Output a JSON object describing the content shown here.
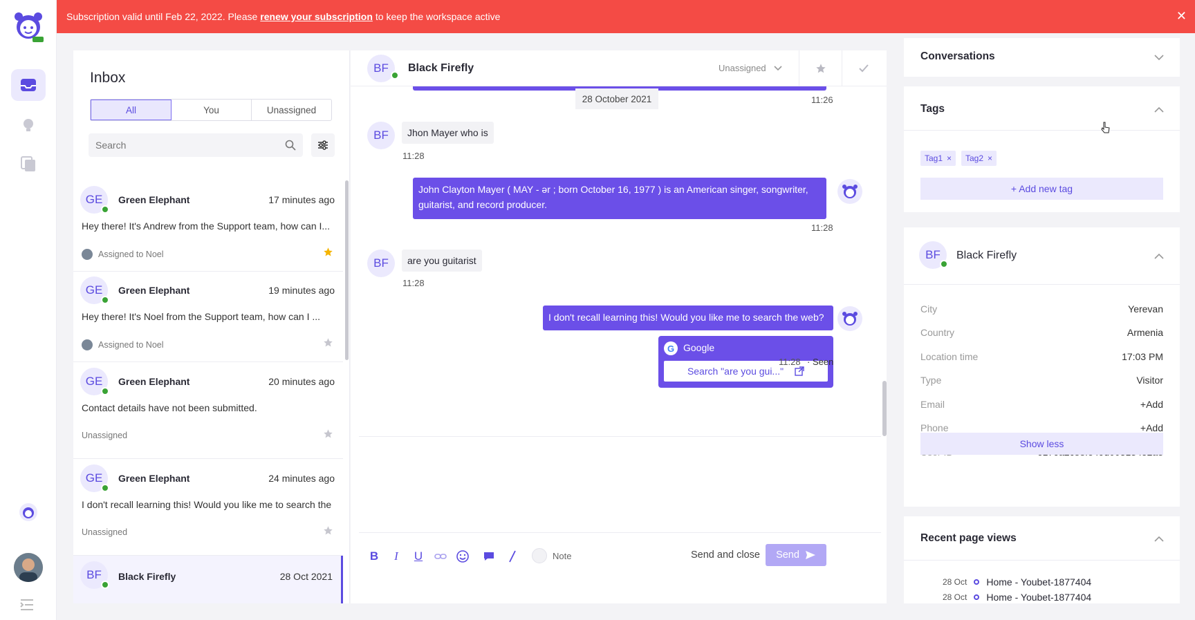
{
  "banner": {
    "text_before": "Subscription valid until Feb 22, 2022. Please",
    "link": "renew your subscription",
    "text_after": "to keep the workspace active",
    "close": "✕"
  },
  "inbox": {
    "title": "Inbox",
    "tabs": [
      "All",
      "You",
      "Unassigned"
    ],
    "search_placeholder": "Search",
    "conversations": [
      {
        "initials": "GE",
        "name": "Green Elephant",
        "time": "17 minutes ago",
        "message": "Hey there! It's Andrew from the Support team, how can I...",
        "assigned": "Assigned to Noel",
        "starred": true
      },
      {
        "initials": "GE",
        "name": "Green Elephant",
        "time": "19 minutes ago",
        "message": "Hey there! It's Noel from the Support team, how can I ...",
        "assigned": "Assigned to Noel",
        "starred": false
      },
      {
        "initials": "GE",
        "name": "Green Elephant",
        "time": "20 minutes ago",
        "message": "Contact details have not been submitted.",
        "assigned": "Unassigned",
        "starred": false
      },
      {
        "initials": "GE",
        "name": "Green Elephant",
        "time": "24 minutes ago",
        "message": "I don't recall learning this! Would you like me to search the",
        "assigned": "Unassigned",
        "starred": false
      },
      {
        "initials": "BF",
        "name": "Black Firefly",
        "time": "28 Oct 2021"
      }
    ]
  },
  "chat": {
    "initials": "BF",
    "name": "Black Firefly",
    "assignment": "Unassigned",
    "top_time": "11:26",
    "date_chip": "28 October 2021",
    "messages": [
      {
        "text": "Jhon Mayer who is",
        "time": "11:28"
      },
      {
        "text": "John Clayton Mayer ( MAY - ər ; born October 16, 1977 ) is an American singer, songwriter, guitarist, and record producer.",
        "time": "11:28"
      },
      {
        "text": "are you guitarist",
        "time": "11:28"
      },
      {
        "text": "I don't recall learning this! Would you like me to search the web?",
        "time": "11:28",
        "status": "· Seen"
      }
    ],
    "google_card": {
      "title": "Google",
      "button": "Search \"are you gui...\""
    },
    "composer": {
      "note_label": "Note",
      "send_close": "Send and close",
      "send": "Send"
    }
  },
  "right": {
    "conversations_title": "Conversations",
    "tags_title": "Tags",
    "tags": [
      "Tag1",
      "Tag2"
    ],
    "add_tag": "+ Add new tag",
    "contact": {
      "initials": "BF",
      "name": "Black Firefly",
      "attrs": [
        {
          "k": "City",
          "v": "Yerevan"
        },
        {
          "k": "Country",
          "v": "Armenia"
        },
        {
          "k": "Location time",
          "v": "17:03 PM"
        },
        {
          "k": "Type",
          "v": "Visitor"
        },
        {
          "k": "Email",
          "v": "+Add"
        },
        {
          "k": "Phone",
          "v": "+Add"
        },
        {
          "k": "User ID",
          "v": "6176a2c88fe49d00313452a8"
        }
      ],
      "show_less": "Show less"
    },
    "page_views_title": "Recent page views",
    "page_views": [
      {
        "date": "28 Oct",
        "page": "Home - Youbet-1877404"
      },
      {
        "date": "28 Oct",
        "page": "Home - Youbet-1877404"
      }
    ]
  },
  "colors": {
    "accent": "#6b4fe8",
    "banner": "#f44b45",
    "online": "#3aa335"
  }
}
